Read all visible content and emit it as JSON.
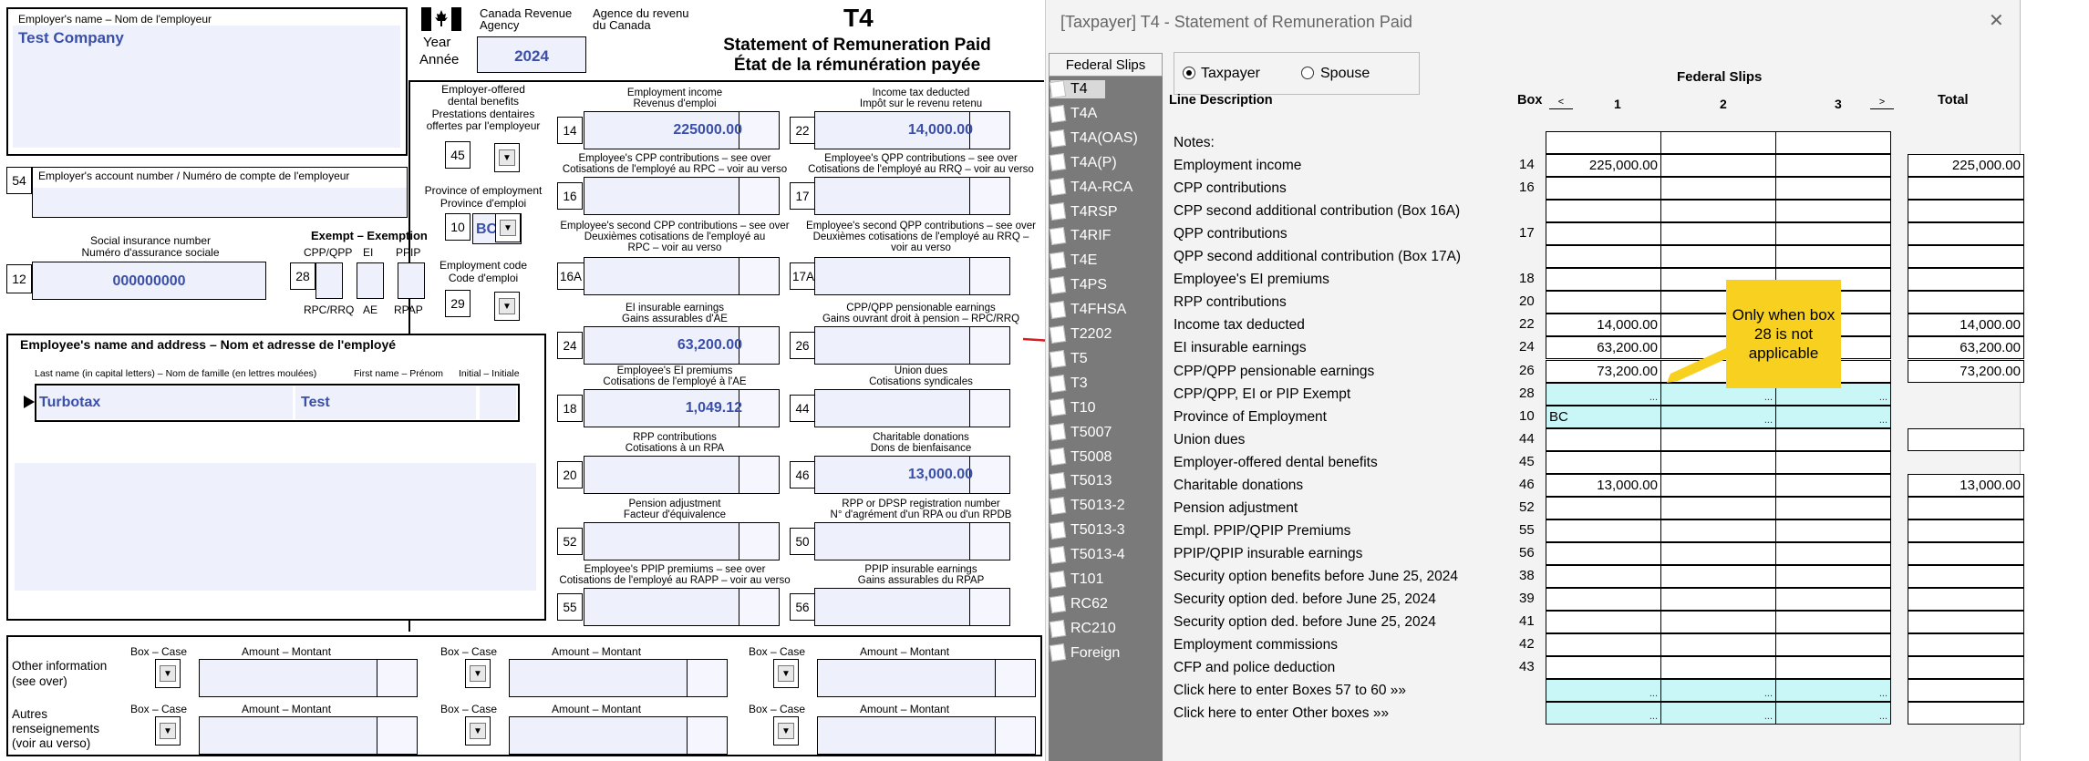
{
  "t4": {
    "employer_name_label": "Employer's name – Nom de l'employeur",
    "employer_name": "Test Company",
    "cra_en_1": "Canada Revenue",
    "cra_en_2": "Agency",
    "cra_fr_1": "Agence du revenu",
    "cra_fr_2": "du Canada",
    "form_code": "T4",
    "title_en": "Statement of Remuneration Paid",
    "title_fr": "État de la rémunération payée",
    "year_label_1": "Year",
    "year_label_2": "Année",
    "year": "2024",
    "dental_label": [
      "Employer-offered",
      "dental benefits",
      "Prestations dentaires",
      "offertes par l'employeur"
    ],
    "box45": "45",
    "province_label": [
      "Province of employment",
      "Province d'emploi"
    ],
    "box10": "10",
    "province": "BC",
    "emp_code_label": [
      "Employment code",
      "Code d'emploi"
    ],
    "box29": "29",
    "box54": "54",
    "account_label": "Employer's account number / Numéro de compte de l'employeur",
    "sin_label": [
      "Social insurance number",
      "Numéro d'assurance sociale"
    ],
    "box12": "12",
    "sin": "000000000",
    "exempt_label": "Exempt – Exemption",
    "exempt_top": [
      "CPP/QPP",
      "EI",
      "PPIP"
    ],
    "exempt_bottom": [
      "RPC/RRQ",
      "AE",
      "RPAP"
    ],
    "box28": "28",
    "employee_label": "Employee's name and address – Nom et adresse de l'employé",
    "name_cols": [
      "Last name (in capital letters) – Nom de famille (en lettres moulées)",
      "First name – Prénom",
      "Initial – Initiale"
    ],
    "last_name": "Turbotax",
    "first_name": "Test",
    "boxes": [
      {
        "num": "14",
        "label": [
          "Employment income",
          "Revenus d'emploi"
        ],
        "value": "225000.00"
      },
      {
        "num": "22",
        "label": [
          "Income tax deducted",
          "Impôt sur le revenu retenu"
        ],
        "value": "14,000.00"
      },
      {
        "num": "16",
        "label": [
          "Employee's CPP contributions – see over",
          "Cotisations de l'employé au RPC – voir au verso"
        ],
        "value": ""
      },
      {
        "num": "17",
        "label": [
          "Employee's QPP contributions – see over",
          "Cotisations de l'employé au RRQ – voir au verso"
        ],
        "value": ""
      },
      {
        "num": "16A",
        "label": [
          "Employee's second CPP contributions – see over",
          "Deuxièmes cotisations de l'employé au",
          "RPC – voir au verso"
        ],
        "value": ""
      },
      {
        "num": "17A",
        "label": [
          "Employee's second QPP contributions – see over",
          "Deuxièmes cotisations de l'employé au RRQ –",
          "voir au verso"
        ],
        "value": ""
      },
      {
        "num": "24",
        "label": [
          "EI insurable earnings",
          "Gains assurables d'AE"
        ],
        "value": "63,200.00"
      },
      {
        "num": "26",
        "label": [
          "CPP/QPP pensionable earnings",
          "Gains ouvrant droit à pension – RPC/RRQ"
        ],
        "value": ""
      },
      {
        "num": "18",
        "label": [
          "Employee's EI premiums",
          "Cotisations de l'employé à l'AE"
        ],
        "value": "1,049.12"
      },
      {
        "num": "44",
        "label": [
          "Union dues",
          "Cotisations syndicales"
        ],
        "value": ""
      },
      {
        "num": "20",
        "label": [
          "RPP contributions",
          "Cotisations à un RPA"
        ],
        "value": ""
      },
      {
        "num": "46",
        "label": [
          "Charitable donations",
          "Dons de bienfaisance"
        ],
        "value": "13,000.00"
      },
      {
        "num": "52",
        "label": [
          "Pension adjustment",
          "Facteur d'équivalence"
        ],
        "value": ""
      },
      {
        "num": "50",
        "label": [
          "RPP or DPSP registration number",
          "N° d'agrément d'un RPA ou d'un RPDB"
        ],
        "value": ""
      },
      {
        "num": "55",
        "label": [
          "Employee's PPIP premiums – see over",
          "Cotisations de l'employé au RAPP – voir au verso"
        ],
        "value": ""
      },
      {
        "num": "56",
        "label": [
          "PPIP insurable earnings",
          "Gains assurables du RPAP"
        ],
        "value": ""
      }
    ],
    "other_info_label": [
      "Other information",
      "(see over)"
    ],
    "autres_label": [
      "Autres",
      "renseignements",
      "(voir au verso)"
    ],
    "box_case": "Box – Case",
    "amount_montant": "Amount – Montant"
  },
  "window": {
    "title": "[Taxpayer] T4  - Statement of Remuneration Paid",
    "close": "✕"
  },
  "sidebar": {
    "header": "Federal Slips",
    "items": [
      "T4",
      "T4A",
      "T4A(OAS)",
      "T4A(P)",
      "T4A-RCA",
      "T4RSP",
      "T4RIF",
      "T4E",
      "T4PS",
      "T4FHSA",
      "T2202",
      "T5",
      "T3",
      "T10",
      "T5007",
      "T5008",
      "T5013",
      "T5013-2",
      "T5013-3",
      "T5013-4",
      "T101",
      "RC62",
      "RC210",
      "Foreign"
    ]
  },
  "radio": {
    "taxpayer": "Taxpayer",
    "spouse": "Spouse",
    "selected": "Taxpayer"
  },
  "grid": {
    "title": "Federal Slips",
    "col_line": "Line Description",
    "col_box": "Box",
    "prev": "<",
    "next": ">",
    "cols": [
      "1",
      "2",
      "3"
    ],
    "col_total": "Total",
    "rows": [
      {
        "label": "Notes:",
        "box": "",
        "c1": "",
        "c2": "",
        "c3": "",
        "total": "",
        "cyan": false,
        "has_total": false
      },
      {
        "label": "Employment income",
        "box": "14",
        "c1": "225,000.00",
        "c2": "",
        "c3": "",
        "total": "225,000.00",
        "cyan": false,
        "has_total": true
      },
      {
        "label": "CPP contributions",
        "box": "16",
        "c1": "",
        "c2": "",
        "c3": "",
        "total": "",
        "cyan": false,
        "has_total": true
      },
      {
        "label": "CPP second additional contribution (Box 16A)",
        "box": "",
        "c1": "",
        "c2": "",
        "c3": "",
        "total": "",
        "cyan": false,
        "has_total": true
      },
      {
        "label": "QPP contributions",
        "box": "17",
        "c1": "",
        "c2": "",
        "c3": "",
        "total": "",
        "cyan": false,
        "has_total": true
      },
      {
        "label": "QPP second additional contribution (Box 17A)",
        "box": "",
        "c1": "",
        "c2": "",
        "c3": "",
        "total": "",
        "cyan": false,
        "has_total": true
      },
      {
        "label": "Employee's EI premiums",
        "box": "18",
        "c1": "",
        "c2": "",
        "c3": "",
        "total": "",
        "cyan": false,
        "has_total": true
      },
      {
        "label": "RPP contributions",
        "box": "20",
        "c1": "",
        "c2": "",
        "c3": "",
        "total": "",
        "cyan": false,
        "has_total": true
      },
      {
        "label": "Income tax deducted",
        "box": "22",
        "c1": "14,000.00",
        "c2": "",
        "c3": "",
        "total": "14,000.00",
        "cyan": false,
        "has_total": true
      },
      {
        "label": "EI insurable earnings",
        "box": "24",
        "c1": "63,200.00",
        "c2": "",
        "c3": "",
        "total": "63,200.00",
        "cyan": false,
        "has_total": true
      },
      {
        "label": "CPP/QPP pensionable earnings",
        "box": "26",
        "c1": "73,200.00",
        "c2": "",
        "c3": "",
        "total": "73,200.00",
        "cyan": false,
        "has_total": true
      },
      {
        "label": "CPP/QPP, EI or PIP Exempt",
        "box": "28",
        "c1": "...",
        "c2": "...",
        "c3": "...",
        "total": "",
        "cyan": true,
        "has_total": false
      },
      {
        "label": "Province of Employment",
        "box": "10",
        "c1": "BC",
        "c2": "...",
        "c3": "...",
        "total": "",
        "cyan": true,
        "has_total": false
      },
      {
        "label": "Union dues",
        "box": "44",
        "c1": "",
        "c2": "",
        "c3": "",
        "total": "",
        "cyan": false,
        "has_total": true
      },
      {
        "label": "Employer-offered dental benefits",
        "box": "45",
        "c1": "",
        "c2": "",
        "c3": "",
        "total": "",
        "cyan": false,
        "has_total": false
      },
      {
        "label": "Charitable donations",
        "box": "46",
        "c1": "13,000.00",
        "c2": "",
        "c3": "",
        "total": "13,000.00",
        "cyan": false,
        "has_total": true
      },
      {
        "label": "Pension adjustment",
        "box": "52",
        "c1": "",
        "c2": "",
        "c3": "",
        "total": "",
        "cyan": false,
        "has_total": true
      },
      {
        "label": "Empl. PPIP/QPIP Premiums",
        "box": "55",
        "c1": "",
        "c2": "",
        "c3": "",
        "total": "",
        "cyan": false,
        "has_total": true
      },
      {
        "label": "PPIP/QPIP insurable earnings",
        "box": "56",
        "c1": "",
        "c2": "",
        "c3": "",
        "total": "",
        "cyan": false,
        "has_total": true
      },
      {
        "label": "Security option benefits before June 25, 2024",
        "box": "38",
        "c1": "",
        "c2": "",
        "c3": "",
        "total": "",
        "cyan": false,
        "has_total": true
      },
      {
        "label": "Security option ded. before June 25, 2024",
        "box": "39",
        "c1": "",
        "c2": "",
        "c3": "",
        "total": "",
        "cyan": false,
        "has_total": true
      },
      {
        "label": "Security option ded. before June 25, 2024",
        "box": "41",
        "c1": "",
        "c2": "",
        "c3": "",
        "total": "",
        "cyan": false,
        "has_total": true
      },
      {
        "label": "Employment commissions",
        "box": "42",
        "c1": "",
        "c2": "",
        "c3": "",
        "total": "",
        "cyan": false,
        "has_total": true
      },
      {
        "label": "CFP and police deduction",
        "box": "43",
        "c1": "",
        "c2": "",
        "c3": "",
        "total": "",
        "cyan": false,
        "has_total": true
      },
      {
        "label": "Click here to enter Boxes 57 to 60 »»",
        "box": "",
        "c1": "...",
        "c2": "...",
        "c3": "...",
        "total": "",
        "cyan": true,
        "has_total": true
      },
      {
        "label": "Click here to enter Other boxes »»",
        "box": "",
        "c1": "...",
        "c2": "...",
        "c3": "...",
        "total": "",
        "cyan": true,
        "has_total": true
      }
    ]
  },
  "callout": {
    "text": "Only when box 28 is not applicable",
    "color": "#f7d020"
  },
  "colors": {
    "sidebar_bg": "#7a7a7a",
    "field_bg": "#eef0fc",
    "value_blue": "#3a4fa8",
    "cyan_cell": "#c9f6f7",
    "arrow_red": "#d81e1e"
  }
}
